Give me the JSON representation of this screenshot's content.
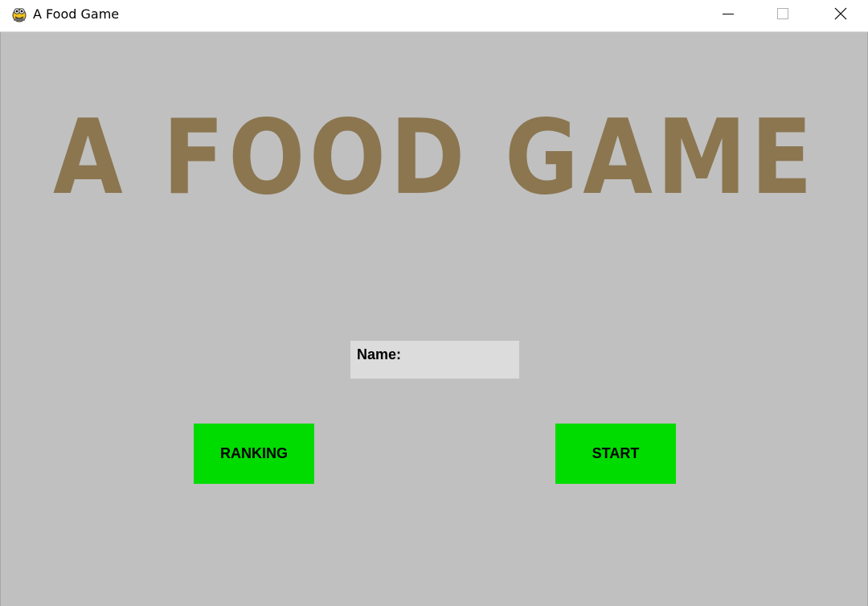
{
  "window": {
    "title": "A Food Game",
    "icon": "pygame-snake-icon",
    "controls": {
      "minimize_icon": "minimize-icon",
      "maximize_icon": "maximize-icon",
      "close_icon": "close-icon"
    }
  },
  "game": {
    "title": "A FOOD GAME",
    "name_field": {
      "label": "Name:",
      "value": ""
    },
    "buttons": {
      "ranking": "RANKING",
      "start": "START"
    }
  },
  "colors": {
    "background": "#c0c0c0",
    "title_text": "#8b7650",
    "button": "#00dc00",
    "input_background": "#dcdcdc"
  }
}
